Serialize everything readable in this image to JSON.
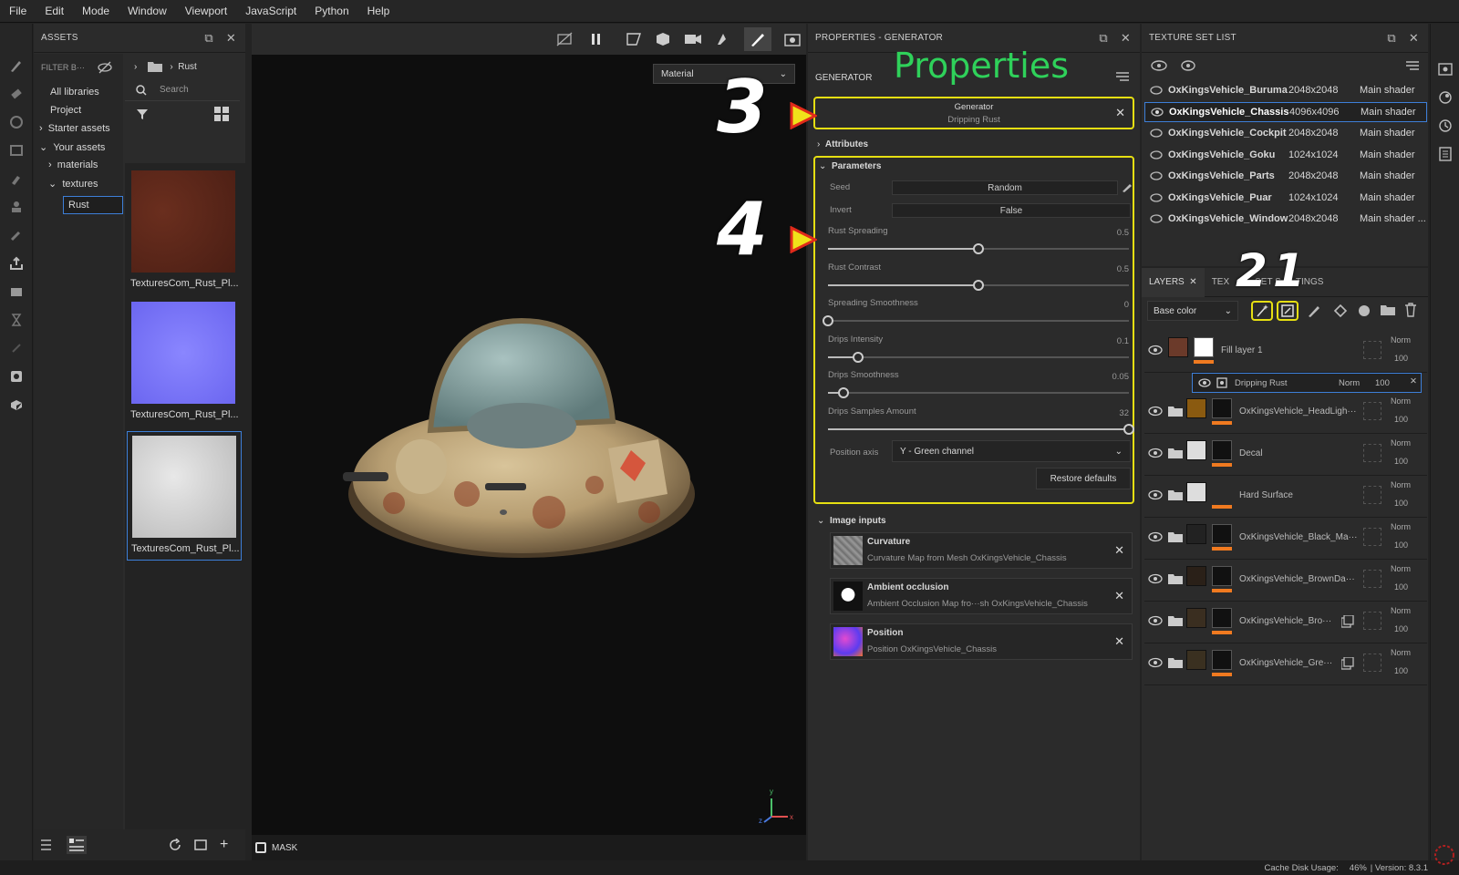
{
  "menu": [
    "File",
    "Edit",
    "Mode",
    "Window",
    "Viewport",
    "JavaScript",
    "Python",
    "Help"
  ],
  "assets": {
    "title": "ASSETS",
    "filter_placeholder": "FILTER B···",
    "breadcrumb": "Rust",
    "search_placeholder": "Search",
    "tree": [
      "All libraries",
      "Project",
      "Starter assets",
      "Your assets",
      "materials",
      "textures",
      "Rust"
    ],
    "thumbs": [
      "TexturesCom_Rust_Pl...",
      "TexturesCom_Rust_Pl...",
      "TexturesCom_Rust_Pl..."
    ]
  },
  "viewport": {
    "dropdown": "Material",
    "mask_label": "MASK",
    "axis_labels": {
      "y": "y",
      "z": "z",
      "x": "x"
    }
  },
  "properties": {
    "title": "PROPERTIES - GENERATOR",
    "section": "GENERATOR",
    "overlay_title": "Properties",
    "generator_name": "Generator",
    "generator_sub": "Dripping Rust",
    "attributes": "Attributes",
    "parameters": "Parameters",
    "seed_label": "Seed",
    "seed_value": "Random",
    "invert_label": "Invert",
    "invert_value": "False",
    "sliders": [
      {
        "label": "Rust Spreading",
        "value": "0.5",
        "fraction": 0.5
      },
      {
        "label": "Rust Contrast",
        "value": "0.5",
        "fraction": 0.5
      },
      {
        "label": "Spreading Smoothness",
        "value": "0",
        "fraction": 0.0
      },
      {
        "label": "Drips Intensity",
        "value": "0.1",
        "fraction": 0.1
      },
      {
        "label": "Drips Smoothness",
        "value": "0.05",
        "fraction": 0.05
      },
      {
        "label": "Drips Samples Amount",
        "value": "32",
        "fraction": 1.0
      }
    ],
    "position_axis_label": "Position axis",
    "position_axis_value": "Y - Green channel",
    "restore": "Restore defaults",
    "image_inputs": "Image inputs",
    "inputs": [
      {
        "name": "Curvature",
        "desc": "Curvature Map from Mesh OxKingsVehicle_Chassis"
      },
      {
        "name": "Ambient occlusion",
        "desc": "Ambient Occlusion Map fro···sh OxKingsVehicle_Chassis"
      },
      {
        "name": "Position",
        "desc": "Position OxKingsVehicle_Chassis"
      }
    ]
  },
  "annotations": {
    "three": "3",
    "four": "4",
    "two": "2",
    "one": "1"
  },
  "texture_set": {
    "title": "TEXTURE SET LIST",
    "items": [
      {
        "name": "OxKingsVehicle_Buruma",
        "res": "2048x2048",
        "shader": "Main shader"
      },
      {
        "name": "OxKingsVehicle_Chassis",
        "res": "4096x4096",
        "shader": "Main shader"
      },
      {
        "name": "OxKingsVehicle_Cockpit",
        "res": "2048x2048",
        "shader": "Main shader"
      },
      {
        "name": "OxKingsVehicle_Goku",
        "res": "1024x1024",
        "shader": "Main shader"
      },
      {
        "name": "OxKingsVehicle_Parts",
        "res": "2048x2048",
        "shader": "Main shader"
      },
      {
        "name": "OxKingsVehicle_Puar",
        "res": "1024x1024",
        "shader": "Main shader"
      },
      {
        "name": "OxKingsVehicle_Window",
        "res": "2048x2048",
        "shader": "Main shader ..."
      }
    ]
  },
  "layers": {
    "tab_layers": "LAYERS",
    "tab_settings_a": "TEX",
    "tab_settings_b": "SET S",
    "tab_settings_c": "TINGS",
    "channel": "Base color",
    "blend": "Norm",
    "opacity": "100",
    "sub_name": "Dripping Rust",
    "items": [
      {
        "name": "Fill layer 1"
      },
      {
        "name": "OxKingsVehicle_HeadLigh···"
      },
      {
        "name": "Decal"
      },
      {
        "name": "Hard Surface"
      },
      {
        "name": "OxKingsVehicle_Black_Ma···"
      },
      {
        "name": "OxKingsVehicle_BrownDa···"
      },
      {
        "name": "OxKingsVehicle_Bro···"
      },
      {
        "name": "OxKingsVehicle_Gre···"
      }
    ]
  },
  "status": {
    "cache_label": "Cache Disk Usage:",
    "cache_value": "46%",
    "version": "| Version: 8.3.1"
  }
}
